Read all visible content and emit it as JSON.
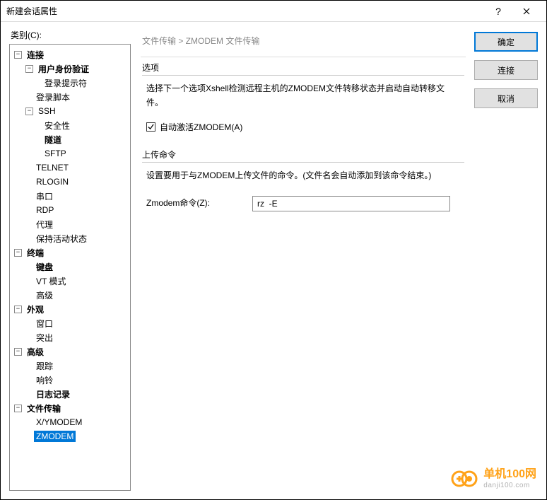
{
  "window": {
    "title": "新建会话属性",
    "help": "?"
  },
  "category_label": "类别(C):",
  "tree": {
    "connection": "连接",
    "userauth": "用户身份验证",
    "loginprompt": "登录提示符",
    "loginscript": "登录脚本",
    "ssh": "SSH",
    "security": "安全性",
    "tunnel": "隧道",
    "sftp": "SFTP",
    "telnet": "TELNET",
    "rlogin": "RLOGIN",
    "serial": "串口",
    "rdp": "RDP",
    "proxy": "代理",
    "keepalive": "保持活动状态",
    "terminal": "终端",
    "keyboard": "键盘",
    "vtmode": "VT 模式",
    "advanced_term": "高级",
    "appearance": "外观",
    "window": "窗口",
    "highlight": "突出",
    "advanced": "高级",
    "trace": "跟踪",
    "bell": "响铃",
    "logging": "日志记录",
    "filetransfer": "文件传输",
    "xymodem": "X/YMODEM",
    "zmodem": "ZMODEM"
  },
  "breadcrumb": "文件传输  >  ZMODEM 文件传输",
  "options": {
    "title": "选项",
    "desc": "选择下一个选项Xshell检测远程主机的ZMODEM文件转移状态并启动自动转移文件。",
    "auto_activate": "自动激活ZMODEM(A)"
  },
  "upload": {
    "title": "上传命令",
    "desc": "设置要用于与ZMODEM上传文件的命令。(文件名会自动添加到该命令结束。)",
    "label": "Zmodem命令(Z):",
    "value": "rz  -E"
  },
  "buttons": {
    "ok": "确定",
    "connect": "连接",
    "cancel": "取消"
  },
  "watermark": {
    "line1": "单机100网",
    "line2": "danji100.com"
  }
}
